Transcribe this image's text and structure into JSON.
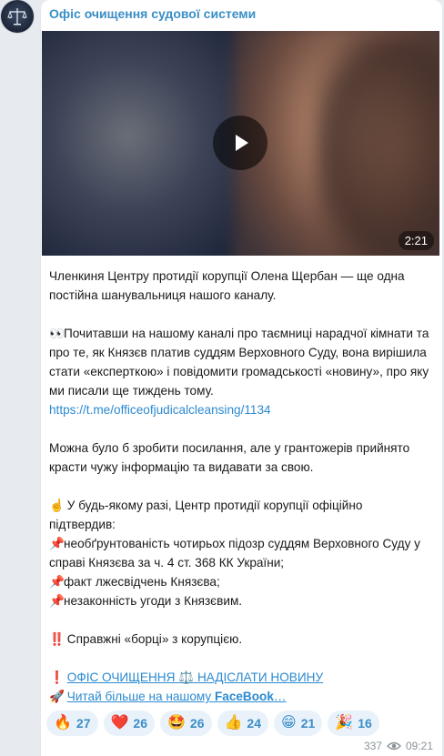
{
  "channel": {
    "name": "Офіс очищення судової системи",
    "avatar_icon": "scales-of-justice-icon"
  },
  "video": {
    "duration": "2:21",
    "play_icon": "play-icon"
  },
  "post": {
    "p1": "Членкиня Центру протидії корупції Олена Щербан — ще одна постійна шанувальниця нашого каналу.",
    "p2_emoji": "👀",
    "p2": "Почитавши на нашому каналі про таємниці нарадчої кімнати та про те, як Князєв платив суддям Верховного Суду, вона вирішила стати «експерткою» і повідомити громадськості «новину», про яку ми писали ще тиждень тому.",
    "p2_link": "https://t.me/officeofjudicalcleansing/1134",
    "p3": "Можна було б зробити посилання, але у грантожерів прийнято красти чужу інформацію та видавати за свою.",
    "p4_emoji": "☝️",
    "p4": "У будь-якому разі, Центр протидії корупції офіційно підтвердив:",
    "pin": "📌",
    "bullets": [
      "необґрунтованість чотирьох підозр суддям Верховного Суду у справі Князєва за ч. 4 ст. 368 КК України;",
      "факт лжесвідчень Князєва;",
      "незаконність угоди з Князєвим."
    ],
    "p5_emoji": "‼️",
    "p5": "Справжні «борці» з корупцією.",
    "cta1_emoji": "❗️",
    "cta1_part1": "ОФІС ОЧИЩЕННЯ",
    "cta1_scales": "⚖️",
    "cta1_part2": "НАДІСЛАТИ НОВИНУ",
    "cta2_emoji": "🚀",
    "cta2_text": "Читай більше на нашому ",
    "cta2_bold": "FaceBook",
    "cta2_ellipsis": "…"
  },
  "reactions": [
    {
      "emoji": "🔥",
      "count": "27"
    },
    {
      "emoji": "❤️",
      "count": "26"
    },
    {
      "emoji": "🤩",
      "count": "26"
    },
    {
      "emoji": "👍",
      "count": "24"
    },
    {
      "emoji": "😁",
      "count": "21"
    },
    {
      "emoji": "🎉",
      "count": "16"
    }
  ],
  "meta": {
    "views": "337",
    "time": "09:21",
    "views_icon": "eye-icon"
  },
  "colors": {
    "accent": "#3a8ec6",
    "link": "#2b8ad0",
    "bubble": "#ffffff",
    "background": "#e7ebf0",
    "reaction_bg": "#e9f2fa"
  }
}
